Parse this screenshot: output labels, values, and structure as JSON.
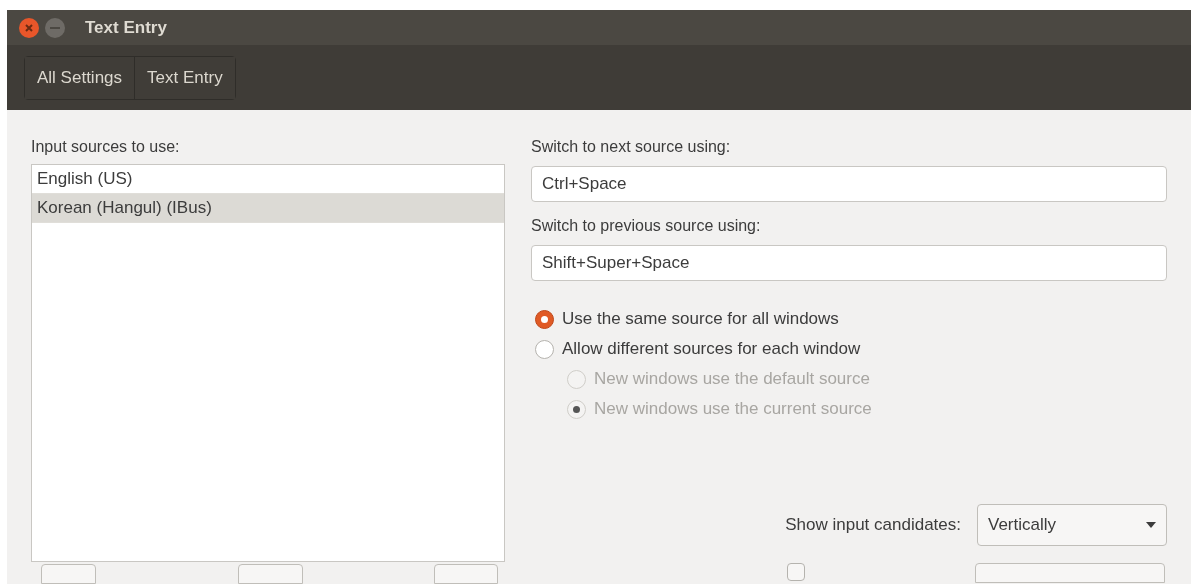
{
  "window": {
    "title": "Text Entry"
  },
  "breadcrumbs": [
    {
      "label": "All Settings"
    },
    {
      "label": "Text Entry"
    }
  ],
  "input_sources": {
    "label": "Input sources to use:",
    "items": [
      {
        "label": "English (US)",
        "selected": false
      },
      {
        "label": "Korean (Hangul) (IBus)",
        "selected": true
      }
    ]
  },
  "next_source": {
    "label": "Switch to next source using:",
    "value": "Ctrl+Space"
  },
  "previous_source": {
    "label": "Switch to previous source using:",
    "value": "Shift+Super+Space"
  },
  "radios": [
    {
      "label": "Use the same source for all windows",
      "selected": true,
      "disabled": false,
      "indented": false
    },
    {
      "label": "Allow different sources for each window",
      "selected": false,
      "disabled": false,
      "indented": false
    },
    {
      "label": "New windows use the default source",
      "selected": false,
      "disabled": true,
      "indented": true
    },
    {
      "label": "New windows use the current source",
      "selected": true,
      "disabled": true,
      "indented": true
    }
  ],
  "candidates": {
    "label": "Show input candidates:",
    "value": "Vertically"
  },
  "bottom_checkbox": {
    "checked": false
  }
}
